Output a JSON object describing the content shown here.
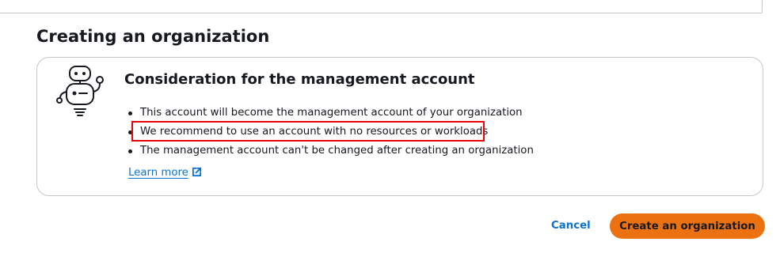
{
  "section": {
    "title": "Creating an organization"
  },
  "card": {
    "title": "Consideration for the management account",
    "bullets": [
      "This account will become the management account of your organization",
      "We recommend to use an account with no resources or workloads",
      "The management account can't be changed after creating an organization"
    ],
    "learn_more_label": "Learn more",
    "illustration_icon": "robot-icon",
    "link_icon": "external-link-icon"
  },
  "actions": {
    "cancel_label": "Cancel",
    "create_label": "Create an organization"
  },
  "colors": {
    "primary_button": "#ec7211",
    "link": "#0972d3",
    "highlight_border": "#e8000b",
    "card_border": "#c6c6cd"
  }
}
